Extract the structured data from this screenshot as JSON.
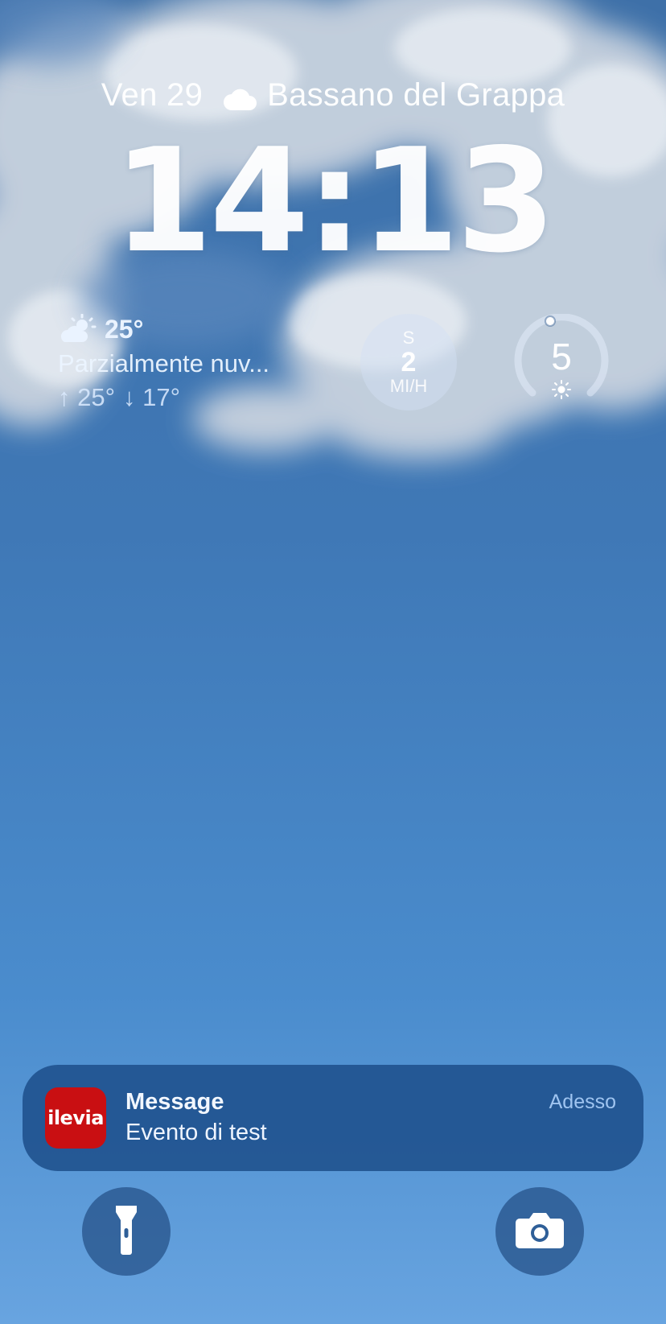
{
  "lockscreen": {
    "date": "Ven 29",
    "location": "Bassano del Grappa",
    "time": "14:13"
  },
  "weather": {
    "icon": "sun-behind-cloud-icon",
    "temperature": "25°",
    "condition": "Parzialmente nuv...",
    "high": "↑ 25°",
    "low": "↓ 17°"
  },
  "wind": {
    "direction": "S",
    "speed": "2",
    "unit": "MI/H"
  },
  "uv_index": {
    "value": "5",
    "level_fraction": 0.5
  },
  "notification": {
    "app_icon_text": "ilevia",
    "title": "Message",
    "body": "Evento di test",
    "time": "Adesso",
    "app_icon_color": "#c90f12"
  },
  "quick_actions": {
    "left_icon": "flashlight-icon",
    "right_icon": "camera-icon"
  }
}
